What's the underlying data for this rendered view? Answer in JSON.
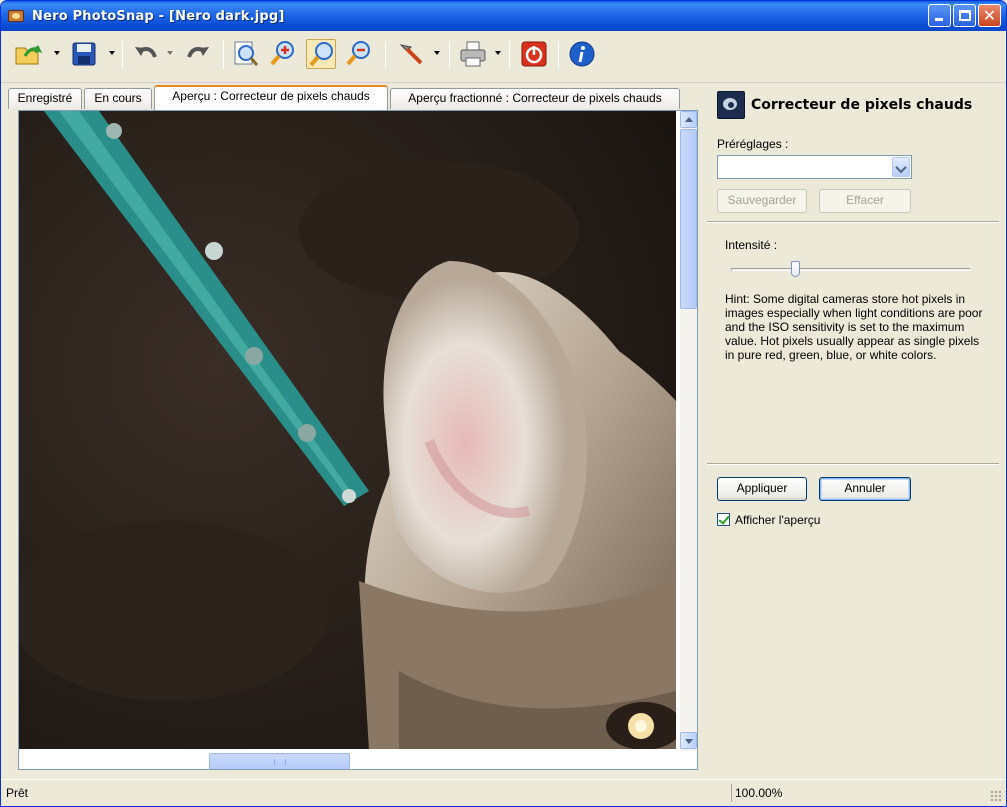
{
  "window": {
    "title": "Nero PhotoSnap - [Nero dark.jpg]"
  },
  "toolbar": {
    "items": [
      {
        "name": "open-icon",
        "color": "#2b9b2f"
      },
      {
        "name": "save-icon",
        "color": "#2a56b8"
      },
      {
        "name": "undo-icon",
        "color": "#555555"
      },
      {
        "name": "redo-icon",
        "color": "#555555"
      },
      {
        "name": "fit-to-window-icon",
        "color": "#2a6acb"
      },
      {
        "name": "zoom-in-icon",
        "color": "#2a6acb"
      },
      {
        "name": "zoom-icon",
        "color": "#2a6acb"
      },
      {
        "name": "zoom-out-icon",
        "color": "#2a6acb"
      },
      {
        "name": "tools-icon",
        "color": "#c7441c"
      },
      {
        "name": "print-icon",
        "color": "#6a6a6a"
      },
      {
        "name": "exit-icon",
        "color": "#d8321c"
      },
      {
        "name": "about-icon",
        "color": "#1f5fc9"
      }
    ]
  },
  "tabs": [
    {
      "label": "Enregistré",
      "active": false
    },
    {
      "label": "En cours",
      "active": false
    },
    {
      "label": "Aperçu : Correcteur de pixels chauds",
      "active": true
    },
    {
      "label": "Aperçu fractionné : Correcteur de pixels chauds",
      "active": false
    }
  ],
  "panel": {
    "title": "Correcteur de pixels chauds",
    "presets_label": "Préréglages :",
    "presets_value": "",
    "save_label": "Sauvegarder",
    "delete_label": "Effacer",
    "intensity_label": "Intensité :",
    "intensity_value": 0.27,
    "hint": "Hint: Some digital cameras store hot pixels in images especially when light conditions are poor and the ISO sensitivity is set to the maximum value. Hot pixels usually appear as single pixels in pure red, green, blue, or white colors.",
    "apply_label": "Appliquer",
    "cancel_label": "Annuler",
    "show_preview_label": "Afficher l'aperçu",
    "show_preview_checked": true
  },
  "status": {
    "text": "Prêt",
    "zoom": "100.00%"
  }
}
